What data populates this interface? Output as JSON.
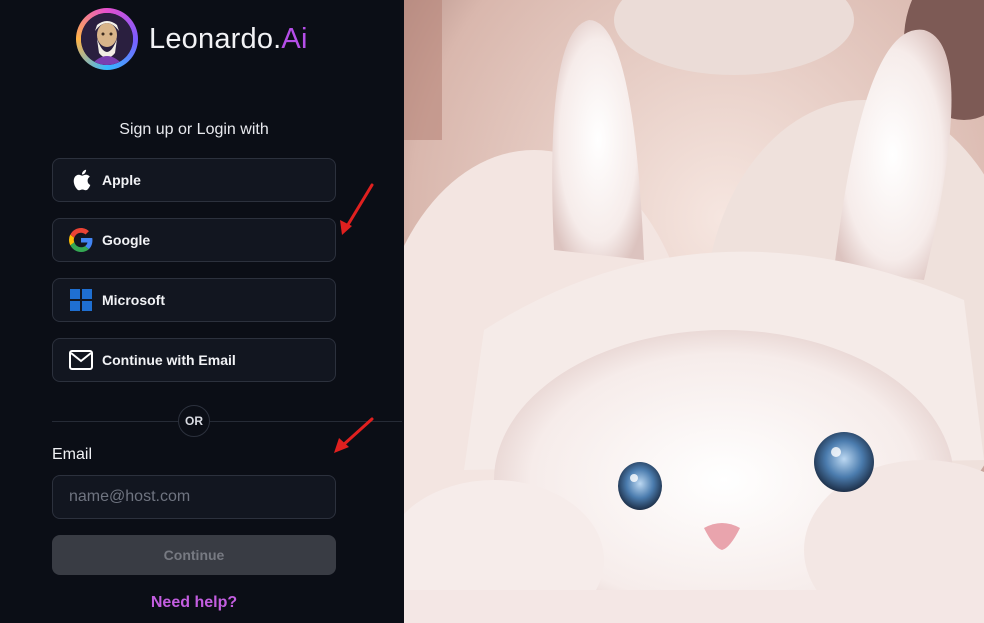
{
  "brand": {
    "name_main": "Leonardo.",
    "name_accent": "Ai",
    "accent_color": "#b54ee8"
  },
  "auth": {
    "heading": "Sign up or Login with",
    "providers": [
      {
        "label": "Apple",
        "icon": "apple-icon"
      },
      {
        "label": "Google",
        "icon": "google-icon"
      },
      {
        "label": "Microsoft",
        "icon": "microsoft-icon"
      },
      {
        "label": "Continue with Email",
        "icon": "mail-icon"
      }
    ],
    "divider_text": "OR",
    "email_label": "Email",
    "email_placeholder": "name@host.com",
    "continue_label": "Continue",
    "help_link": "Need help?"
  },
  "colors": {
    "panel_bg": "#0b0e16",
    "button_bg": "#121620",
    "help_link": "#c35ee0",
    "annotation_arrow": "#e0201f"
  }
}
